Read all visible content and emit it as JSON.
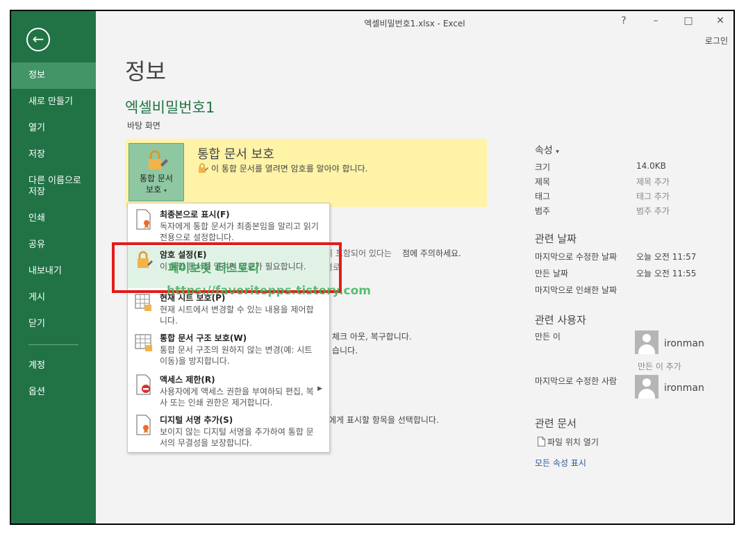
{
  "window": {
    "title": "엑셀비밀번호1.xlsx - Excel",
    "help": "?",
    "minimize": "–",
    "maximize": "□",
    "close": "✕",
    "login": "로그인"
  },
  "sidebar": {
    "back_icon": "←",
    "items": [
      {
        "label": "정보"
      },
      {
        "label": "새로 만들기"
      },
      {
        "label": "열기"
      },
      {
        "label": "저장"
      },
      {
        "label": "다른 이름으로 저장"
      },
      {
        "label": "인쇄"
      },
      {
        "label": "공유"
      },
      {
        "label": "내보내기"
      },
      {
        "label": "게시"
      },
      {
        "label": "닫기"
      },
      {
        "label": "계정"
      },
      {
        "label": "옵션"
      }
    ]
  },
  "page": {
    "title": "정보",
    "doc_name": "엑셀비밀번호1",
    "doc_location": "바탕 화면"
  },
  "protect": {
    "button_label_1": "통합 문서",
    "button_label_2": "보호",
    "button_caret": "▾",
    "heading": "통합 문서 보호",
    "description": "이 통합 문서를 열려면 암호를 알아야 합니다."
  },
  "background_text": {
    "inspect_partial": "이 포함되어 있다는",
    "inspect_end": "점에 주의하세요.",
    "inspect_path": "경로",
    "versions_partial": "체크 아웃, 복구합니다.",
    "versions_partial2": "습니다.",
    "browser_partial": "에게 표시할 항목을 선택합니다."
  },
  "menu": {
    "items": [
      {
        "title": "최종본으로 표시(F)",
        "desc": "독자에게 통합 문서가 최종본임을 알리고 읽기 전용으로 설정합니다.",
        "icon": "mark-final-icon"
      },
      {
        "title": "암호 설정(E)",
        "desc": "이 통합 문서를 열려면 암호가 필요합니다.",
        "icon": "encrypt-password-icon"
      },
      {
        "title": "현재 시트 보호(P)",
        "desc": "현재 시트에서 변경할 수 있는 내용을 제어합니다.",
        "icon": "protect-sheet-icon"
      },
      {
        "title": "통합 문서 구조 보호(W)",
        "desc": "통합 문서 구조의 원하지 않는 변경(예: 시트 이동)을 방지합니다.",
        "icon": "protect-structure-icon"
      },
      {
        "title": "액세스 제한(R)",
        "desc": "사용자에게 액세스 권한을 부여하되 편집, 복사 또는 인쇄 권한은 제거합니다.",
        "icon": "restrict-access-icon",
        "arrow": "▶"
      },
      {
        "title": "디지털 서명 추가(S)",
        "desc": "보이지 않는 디지털 서명을 추가하여 통합 문서의 무결성을 보장합니다.",
        "icon": "digital-signature-icon"
      }
    ]
  },
  "watermark": {
    "line1": "페이보릿 티스토리",
    "line2": "https://favoritepps.tistory.com"
  },
  "properties": {
    "heading": "속성",
    "caret": "▾",
    "rows": [
      {
        "label": "크기",
        "value": "14.0KB"
      },
      {
        "label": "제목",
        "value": "제목 추가"
      },
      {
        "label": "태그",
        "value": "태그 추가"
      },
      {
        "label": "범주",
        "value": "범주 추가"
      }
    ]
  },
  "related_dates": {
    "heading": "관련 날짜",
    "rows": [
      {
        "label": "마지막으로 수정한 날짜",
        "value": "오늘 오전 11:57"
      },
      {
        "label": "만든 날짜",
        "value": "오늘 오전 11:55"
      },
      {
        "label": "마지막으로 인쇄한 날짜",
        "value": ""
      }
    ]
  },
  "related_people": {
    "heading": "관련 사용자",
    "author_label": "만든 이",
    "author_name": "ironman",
    "add_author": "만든 이 추가",
    "last_modified_label": "마지막으로 수정한 사람",
    "last_modified_name": "ironman"
  },
  "related_docs": {
    "heading": "관련 문서",
    "open_location": "파일 위치 열기",
    "show_all": "모든 속성 표시"
  },
  "colors": {
    "sidebar": "#217346",
    "sidebar_active": "#439467",
    "protect_bg": "#fff3a8",
    "highlight_box": "#e41b1b",
    "watermark": "#2e9d4d"
  }
}
